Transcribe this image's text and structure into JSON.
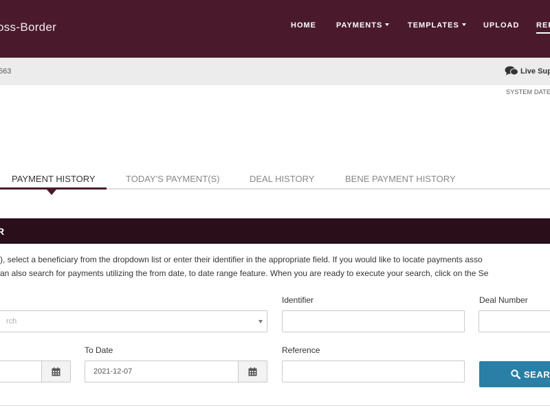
{
  "header": {
    "brand": "oss-Border",
    "nav": [
      {
        "label": "HOME",
        "dropdown": false
      },
      {
        "label": "PAYMENTS",
        "dropdown": true
      },
      {
        "label": "TEMPLATES",
        "dropdown": true
      },
      {
        "label": "UPLOAD",
        "dropdown": false
      },
      {
        "label": "REP",
        "dropdown": false,
        "active": true
      }
    ]
  },
  "subbar": {
    "account": "563",
    "live_support": "Live Sup",
    "system_date": "SYSTEM DATE"
  },
  "tabs": [
    {
      "label": "PAYMENT HISTORY",
      "active": true
    },
    {
      "label": "TODAY'S PAYMENT(S)",
      "active": false
    },
    {
      "label": "DEAL HISTORY",
      "active": false
    },
    {
      "label": "BENE PAYMENT HISTORY",
      "active": false
    }
  ],
  "section": {
    "title": "R",
    "instructions": [
      "s), select a beneficiary from the dropdown list or enter their identifier in the appropriate field. If you would like to locate payments asso",
      "can also search for payments utilizing the from date, to date range feature. When you are ready to execute your search, click on the Se"
    ]
  },
  "form": {
    "beneficiary": {
      "placeholder": "rch"
    },
    "identifier": {
      "label": "Identifier",
      "value": ""
    },
    "deal_number": {
      "label": "Deal Number",
      "value": ""
    },
    "from_date": {
      "value": ""
    },
    "to_date": {
      "label": "To Date",
      "value": "2021-12-07"
    },
    "reference": {
      "label": "Reference",
      "value": ""
    },
    "search_button": "SEAR"
  },
  "colors": {
    "header_bg": "#4a1a2c",
    "section_bg": "#2a0e19",
    "button_bg": "#2a7fa6",
    "subbar_bg": "#ececec"
  },
  "icons": {
    "support": "chat-bubbles-icon",
    "calendar": "calendar-icon",
    "search": "search-icon",
    "dropdown": "caret-down-icon"
  }
}
